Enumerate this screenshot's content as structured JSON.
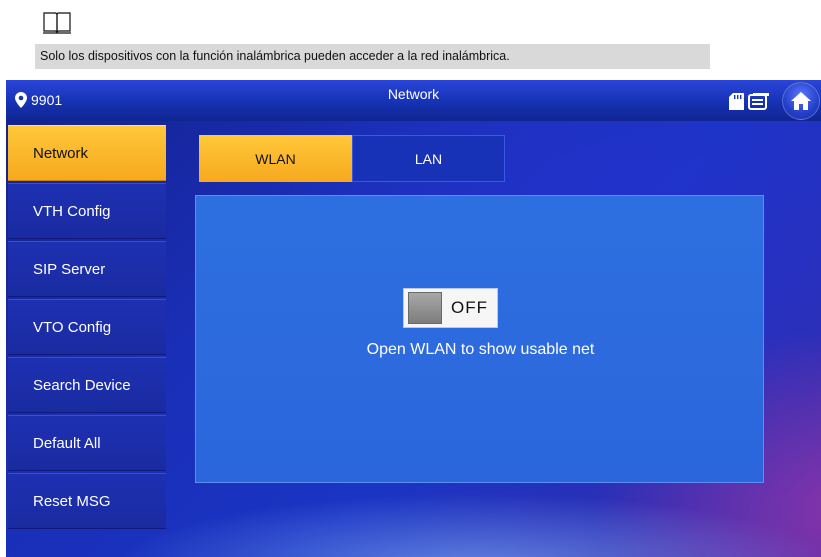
{
  "doc": {
    "note_icon": "book-icon",
    "note_text": "Solo los dispositivos con la función inalámbrica pueden acceder a la red inalámbrica."
  },
  "screen": {
    "title": "Network",
    "location": {
      "icon": "location-pin-icon",
      "label": "9901"
    },
    "header_icons": [
      "sd-card-icon",
      "message-icon",
      "home-icon"
    ],
    "sidebar": {
      "items": [
        {
          "label": "Network",
          "active": true
        },
        {
          "label": "VTH Config",
          "active": false
        },
        {
          "label": "SIP Server",
          "active": false
        },
        {
          "label": "VTO Config",
          "active": false
        },
        {
          "label": "Search Device",
          "active": false
        },
        {
          "label": "Default All",
          "active": false
        },
        {
          "label": "Reset MSG",
          "active": false
        }
      ]
    },
    "tabs": [
      {
        "label": "WLAN",
        "active": true
      },
      {
        "label": "LAN",
        "active": false
      }
    ],
    "wlan": {
      "toggle_state": "OFF",
      "message": "Open WLAN to show usable net"
    }
  },
  "colors": {
    "accent": "#f7a91d",
    "background": "#1a34c4",
    "panel": "#2b66dc"
  }
}
